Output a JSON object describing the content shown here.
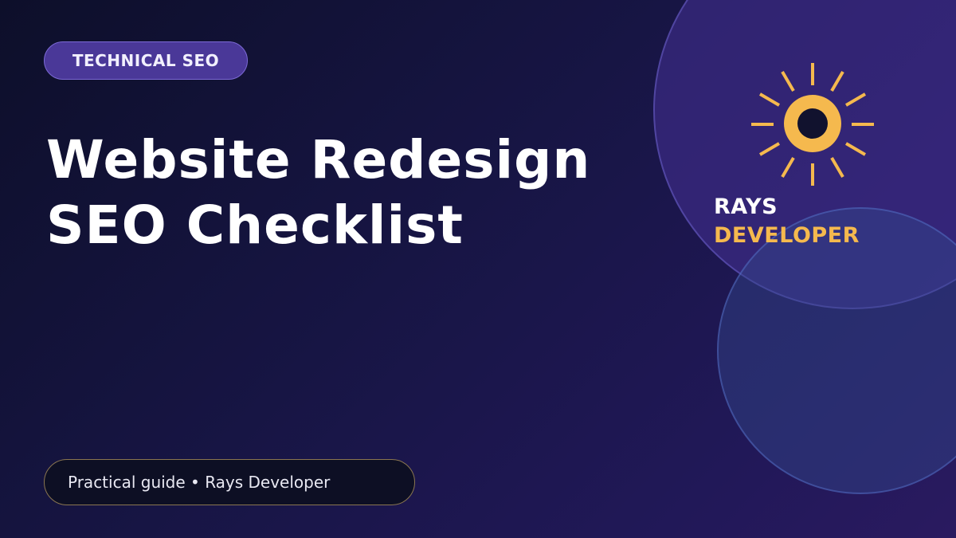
{
  "badge": {
    "label": "TECHNICAL SEO"
  },
  "title": {
    "line1": "Website Redesign",
    "line2": "SEO Checklist"
  },
  "brand": {
    "icon": "sun-icon",
    "line1": "RAYS",
    "line2": "DEVELOPER"
  },
  "footer": {
    "text": "Practical guide • Rays Developer"
  },
  "colors": {
    "accent": "#f5b94e",
    "badge_bg": "#4a3898",
    "background": "#171544"
  }
}
